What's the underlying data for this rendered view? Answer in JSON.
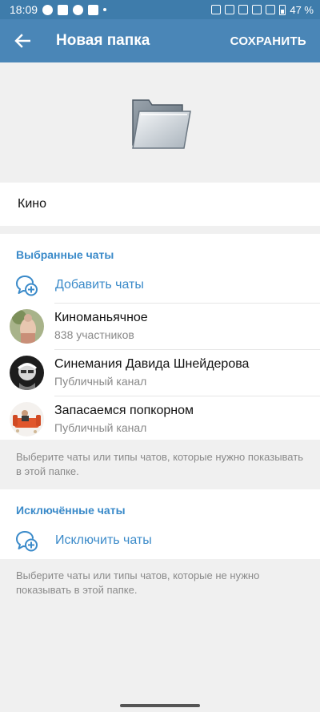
{
  "status_bar": {
    "time": "18:09",
    "battery": "47 %"
  },
  "app_bar": {
    "title": "Новая папка",
    "save_label": "СОХРАНИТЬ"
  },
  "folder": {
    "name": "Кино"
  },
  "included": {
    "header": "Выбранные чаты",
    "add_label": "Добавить чаты",
    "chats": [
      {
        "name": "Киноманьячное",
        "subtitle": "838 участников"
      },
      {
        "name": "Синемания Давида Шнейдерова",
        "subtitle": "Публичный канал"
      },
      {
        "name": "Запасаемся попкорном",
        "subtitle": "Публичный канал"
      }
    ],
    "hint": "Выберите чаты или типы чатов, которые нужно показывать в этой папке."
  },
  "excluded": {
    "header": "Исключённые чаты",
    "add_label": "Исключить чаты",
    "hint": "Выберите чаты или типы чатов, которые не нужно показывать в этой папке."
  },
  "colors": {
    "accent": "#3a8ac9",
    "app_bar": "#4a86b7",
    "status_bar": "#3e7cab"
  }
}
